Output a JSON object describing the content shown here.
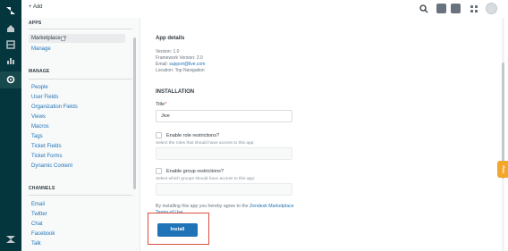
{
  "topbar": {
    "add_label": "+ Add"
  },
  "settings_panel": {
    "apps": {
      "title": "APPS",
      "items": [
        {
          "label": "Marketplace"
        },
        {
          "label": "Manage"
        }
      ]
    },
    "manage": {
      "title": "MANAGE",
      "items": [
        {
          "label": "People"
        },
        {
          "label": "User Fields"
        },
        {
          "label": "Organization Fields"
        },
        {
          "label": "Views"
        },
        {
          "label": "Macros"
        },
        {
          "label": "Tags"
        },
        {
          "label": "Ticket Fields"
        },
        {
          "label": "Ticket Forms"
        },
        {
          "label": "Dynamic Content"
        }
      ]
    },
    "channels": {
      "title": "CHANNELS",
      "items": [
        {
          "label": "Email"
        },
        {
          "label": "Twitter"
        },
        {
          "label": "Chat"
        },
        {
          "label": "Facebook"
        },
        {
          "label": "Talk"
        }
      ]
    }
  },
  "app_details": {
    "title": "App details",
    "version": "Version: 1.0",
    "framework": "Framework Version: 2.0",
    "email_prefix": "Email: ",
    "email": "support@live.com",
    "location": "Location: Top Navigation"
  },
  "installation": {
    "title": "INSTALLATION",
    "title_label": "Title",
    "required_mark": "*",
    "title_value": "Jive",
    "role_restrictions_label": "Enable role restrictions?",
    "role_hint": "Select the roles that should have access to this app:",
    "group_restrictions_label": "Enable group restrictions?",
    "group_hint": "Select which groups should have access to this app:",
    "terms_prefix": "By installing this app you hereby agree to the ",
    "terms_link": "Zendesk Marketplace Terms of Use",
    "terms_suffix": ".",
    "install_label": "Install"
  },
  "help_tab": {
    "label": "Help"
  },
  "colors": {
    "rail": "#03363d",
    "link": "#1f73b7",
    "primary_button": "#1f73b7",
    "highlight_border": "#d94f3d",
    "help_tab": "#f3a62a"
  },
  "icons": {
    "rail": [
      "zendesk-logo-icon",
      "home-icon",
      "views-icon",
      "reporting-icon",
      "admin-gear-icon",
      "zendesk-logo-icon"
    ],
    "topbar": [
      "search-icon",
      "chat-icon",
      "talk-phone-icon",
      "apps-grid-icon",
      "avatar"
    ]
  }
}
